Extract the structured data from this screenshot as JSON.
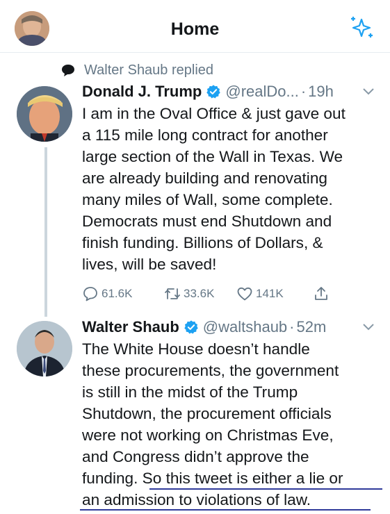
{
  "header": {
    "title": "Home"
  },
  "context": {
    "text": "Walter Shaub replied"
  },
  "tweets": [
    {
      "name": "Donald J. Trump",
      "handle": "@realDo...",
      "separator": "·",
      "time": "19h",
      "lines": [
        "I am in the Oval Office & just gave out",
        "a 115 mile long contract for another",
        "large section of the Wall in Texas. We",
        "are already building and renovating",
        "many miles of Wall, some complete.",
        "Democrats must end Shutdown and",
        "finish funding. Billions of Dollars, &",
        "lives, will be saved!"
      ],
      "stats": {
        "replies": "61.6K",
        "retweets": "33.6K",
        "likes": "141K"
      }
    },
    {
      "name": "Walter Shaub",
      "handle": "@waltshaub",
      "separator": "·",
      "time": "52m",
      "lines": [
        "The White House doesn’t handle",
        "these procurements, the government",
        "is still in the midst of the Trump",
        "Shutdown, the procurement officials",
        "were not working on Christmas Eve,",
        "and Congress didn’t approve the",
        "funding. So this tweet is either a lie or",
        "an admission to violations of law."
      ]
    }
  ],
  "icons": {
    "header_right": "sparkle-icon",
    "context": "reply-bubble-icon",
    "verified": "verified-badge-icon",
    "caret": "chevron-down-icon",
    "reply": "reply-icon",
    "retweet": "retweet-icon",
    "like": "heart-icon",
    "share": "share-icon"
  },
  "colors": {
    "accent": "#1da1f2",
    "secondary_text": "#657786",
    "underline": "#2f3a9a"
  }
}
